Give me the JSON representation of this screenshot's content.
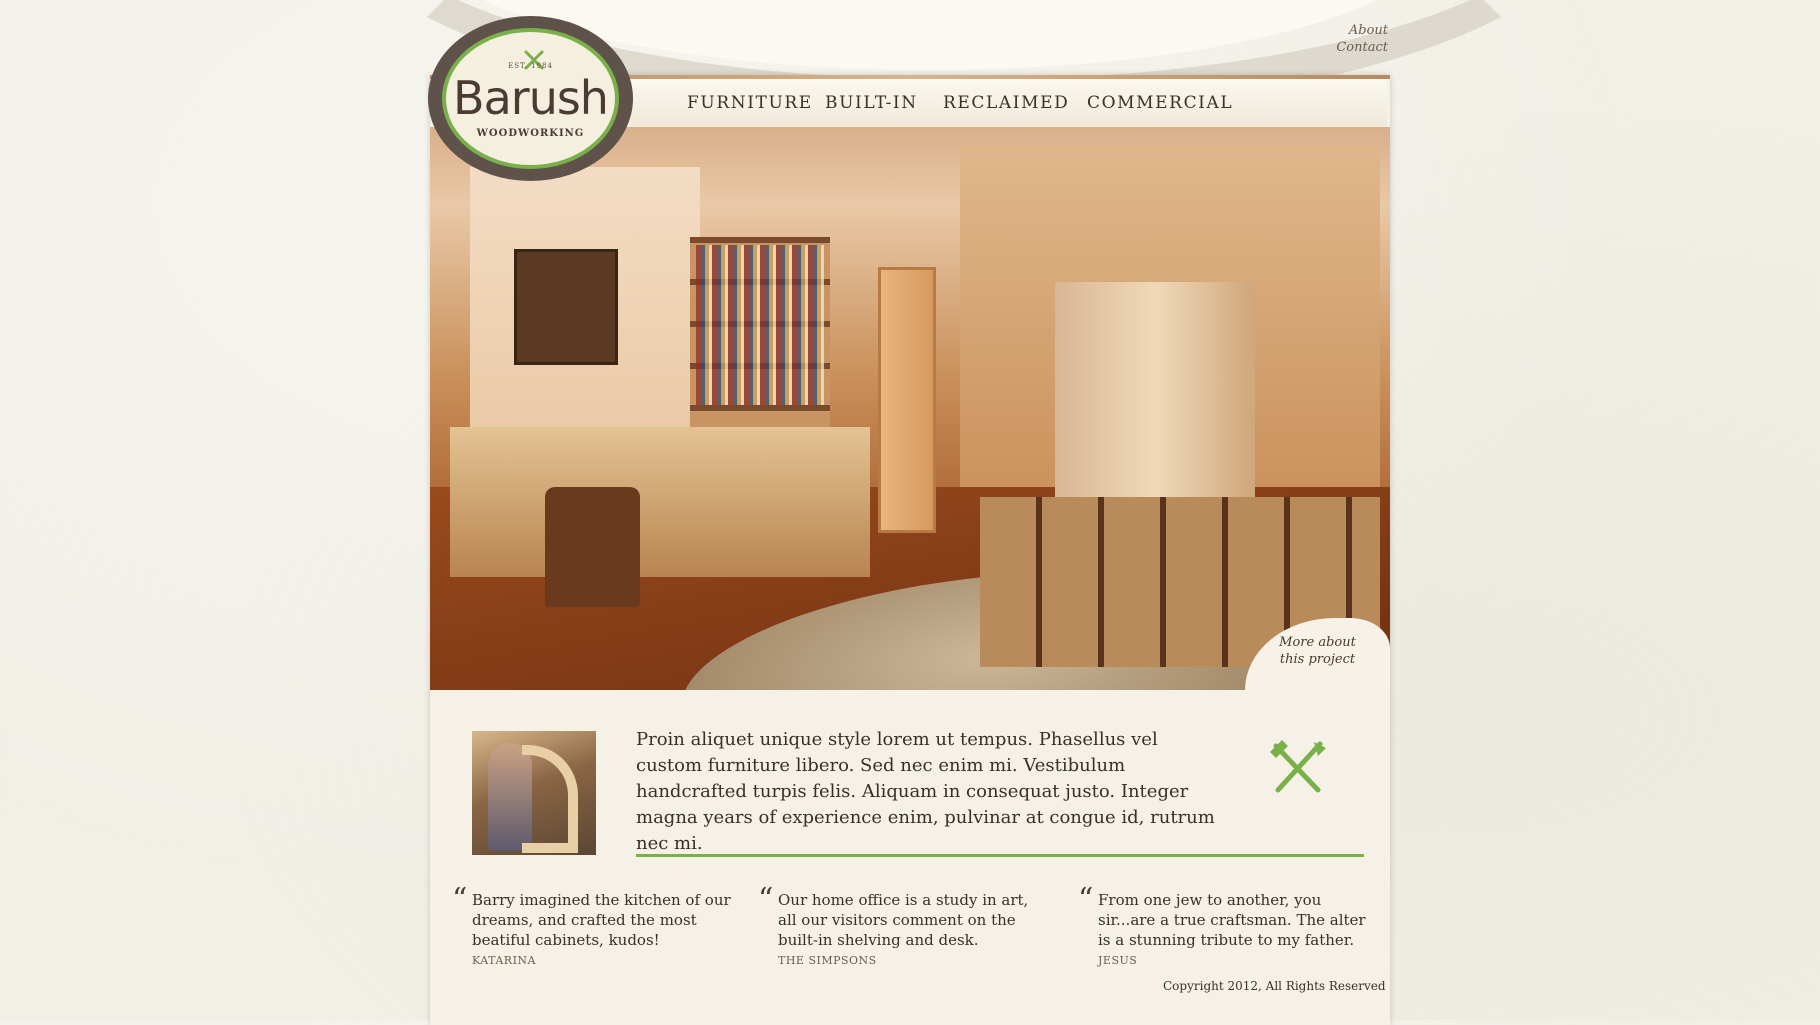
{
  "top_links": [
    "About",
    "Contact"
  ],
  "logo": {
    "est": "EST.  1984",
    "name": "Barush",
    "sub": "WOODWORKING"
  },
  "nav": [
    "FURNITURE",
    "BUILT-IN",
    "RECLAIMED",
    "COMMERCIAL"
  ],
  "hero": {
    "more_label_1": "More about",
    "more_label_2": "this project"
  },
  "intro_text": "Proin aliquet unique style lorem ut tempus. Phasellus vel custom furniture libero. Sed nec enim mi. Vestibulum handcrafted turpis felis. Aliquam in consequat justo. Integer magna years of experience enim, pulvinar at congue id, rutrum nec mi.",
  "quotes": [
    {
      "text": "Barry imagined the kitchen of our dreams, and crafted the most beatiful cabinets, kudos!",
      "name": "KATARINA"
    },
    {
      "text": "Our home office is a study in art, all our visitors comment on the built-in shelving and desk.",
      "name": "THE SIMPSONS"
    },
    {
      "text": "From one jew to another, you sir...are a true craftsman. The alter is a stunning tribute to my father.",
      "name": "JESUS"
    }
  ],
  "quote_mark": "“",
  "copyright": "Copyright 2012, All Rights Reserved",
  "colors": {
    "accent_green": "#7ab04a",
    "logo_ring": "#5e524a",
    "page_bg": "#f6f1e6"
  }
}
